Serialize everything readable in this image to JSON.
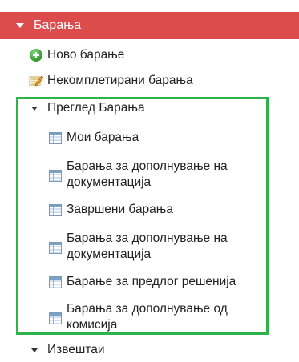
{
  "header": {
    "label": "Барања"
  },
  "menu": {
    "new_request": "Ново барање",
    "incomplete_requests": "Некомплетирани барања",
    "review_requests": "Преглед Барања",
    "reports": "Извештаи"
  },
  "submenu": [
    {
      "label": "Мои барања"
    },
    {
      "label_line1": "Барања за дополнување на",
      "label_line2": "документација"
    },
    {
      "label": "Завршени барања"
    },
    {
      "label_line1": "Барања за дополнување на",
      "label_line2": "документација"
    },
    {
      "label": "Барање за предлог решенија"
    },
    {
      "label_line1": "Барања за дополнување од",
      "label_line2": "комисија"
    }
  ],
  "colors": {
    "header_bg": "#dc4c4c",
    "group_border": "#2db34a"
  }
}
